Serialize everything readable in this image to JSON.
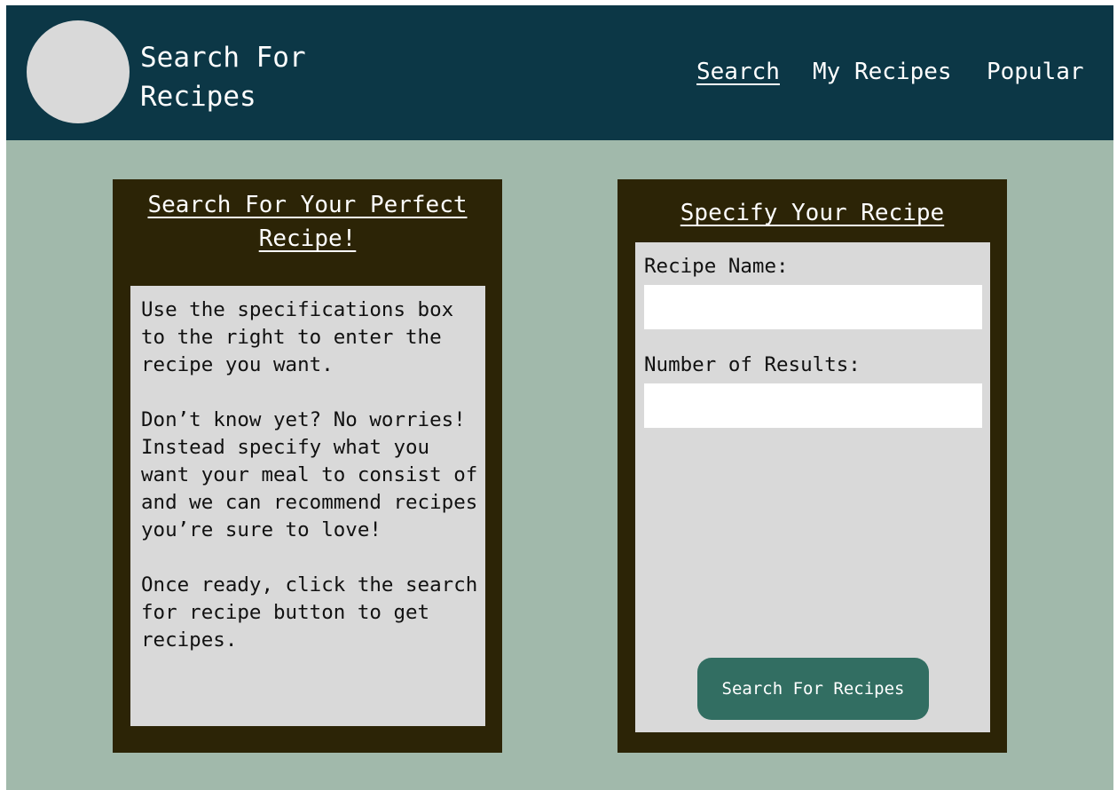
{
  "header": {
    "title": "Search For\nRecipes",
    "nav": {
      "search": "Search",
      "my_recipes": "My Recipes",
      "popular": "Popular"
    }
  },
  "info_panel": {
    "heading_line1": "Search For Your Perfect",
    "heading_line2": "Recipe!",
    "paragraph1": "Use the specifications box to the right to enter the recipe you want.",
    "paragraph2": "Don’t know yet? No worries! Instead specify what you want your meal to consist of and we can recommend recipes you’re sure to love!",
    "paragraph3": "Once ready, click the search for recipe button to get recipes."
  },
  "spec_panel": {
    "heading": "Specify Your Recipe",
    "recipe_name_label": "Recipe Name:",
    "recipe_name_value": "",
    "num_results_label": "Number of Results:",
    "num_results_value": "",
    "search_button_label": "Search For Recipes"
  },
  "colors": {
    "page_background": "#a1b9ab",
    "header_background": "#0c3746",
    "panel_background": "#2c2406",
    "inner_background": "#d9d9d9",
    "button_background": "#326e62"
  }
}
